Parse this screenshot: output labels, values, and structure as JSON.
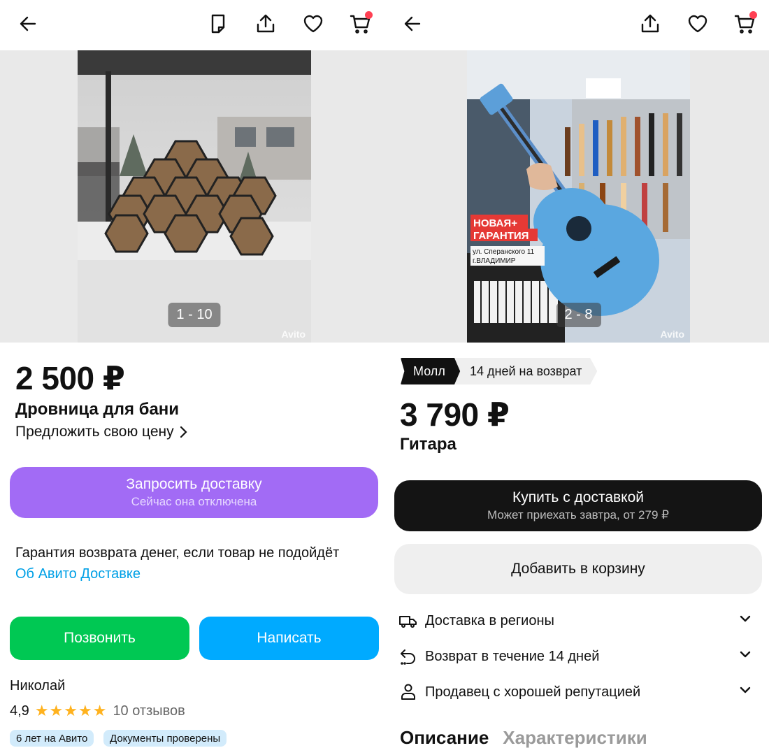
{
  "left": {
    "photo_counter": "1 - 10",
    "watermark": "Avito",
    "price": "2 500 ₽",
    "title": "Дровница для бани",
    "offer_price_label": "Предложить свою цену",
    "delivery_button": {
      "label": "Запросить доставку",
      "sublabel": "Сейчас она отключена",
      "color": "#a26bf5"
    },
    "guarantee_text": "Гарантия возврата денег, если товар не подойдёт",
    "delivery_link": "Об Авито Доставке",
    "call_button": {
      "label": "Позвонить",
      "color": "#00c853"
    },
    "message_button": {
      "label": "Написать",
      "color": "#00aaff"
    },
    "seller": {
      "name": "Николай",
      "rating": "4,9",
      "stars": "★★★★★",
      "reviews": "10 отзывов",
      "badges": [
        "6 лет на Авито",
        "Документы проверены"
      ]
    }
  },
  "right": {
    "photo_counter": "2 - 8",
    "watermark": "Avito",
    "photo_overlay": {
      "line1": "НОВАЯ+",
      "line2": "ГАРАНТИЯ",
      "address1": "ул. Сперанского 11",
      "address2": "г.ВЛАДИМИР"
    },
    "tags": [
      "Молл",
      "14 дней на возврат"
    ],
    "price": "3 790 ₽",
    "title": "Гитара",
    "buy_button": {
      "label": "Купить с доставкой",
      "sublabel": "Может приехать завтра, от 279 ₽",
      "color": "#141414"
    },
    "cart_button": {
      "label": "Добавить в корзину"
    },
    "info_rows": [
      {
        "label": "Доставка в регионы",
        "icon": "truck-icon"
      },
      {
        "label": "Возврат в течение 14 дней",
        "icon": "return-icon"
      },
      {
        "label": "Продавец с хорошей репутацией",
        "icon": "person-icon"
      }
    ],
    "tabs": [
      "Описание",
      "Характеристики"
    ]
  },
  "colors": {
    "accent_red": "#ff4053",
    "link": "#00a0e6",
    "star": "#ffb21e",
    "badge_bg": "#d2ebfb"
  }
}
